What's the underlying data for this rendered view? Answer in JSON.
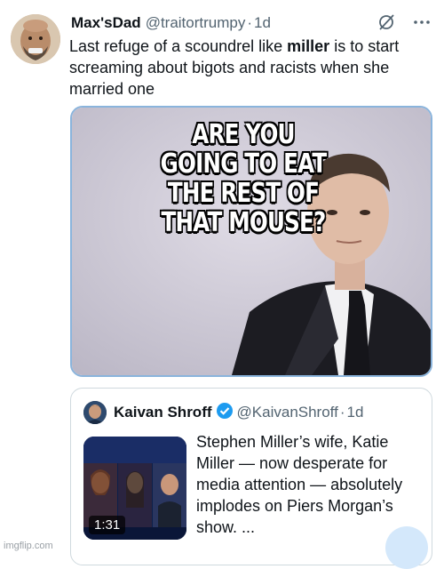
{
  "tweet": {
    "author_name": "Max'sDad",
    "author_handle": "@traitortrumpy",
    "separator": "·",
    "time": "1d",
    "text_before": "Last refuge of a scoundrel like ",
    "text_bold": "miller",
    "text_after": " is to start screaming about bigots and racists when she married one"
  },
  "media": {
    "caption": "ARE YOU GOING TO EAT THE REST OF THAT MOUSE?"
  },
  "quote": {
    "author_name": "Kaivan Shroff",
    "author_handle": "@KaivanShroff",
    "separator": "·",
    "time": "1d",
    "video_duration": "1:31",
    "text": "Stephen Miller’s wife, Katie Miller — now desperate for media attention — absolutely implodes on Piers Morgan’s show. ..."
  },
  "watermark": "imgflip.com",
  "colors": {
    "text": "#0f1419",
    "secondary": "#536471",
    "verified": "#1d9bf0",
    "media_border": "#8ab4dc"
  },
  "icons": [
    "grok-icon",
    "more-icon",
    "verified-badge-icon"
  ]
}
